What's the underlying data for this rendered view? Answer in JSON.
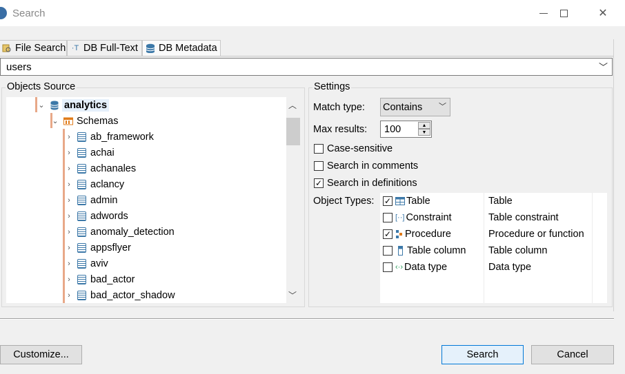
{
  "window": {
    "title": "Search"
  },
  "tabs": [
    {
      "label": "File Search",
      "icon": "file-search-icon"
    },
    {
      "label": "DB Full-Text",
      "icon": "db-full-text-icon"
    },
    {
      "label": "DB Metadata",
      "icon": "db-metadata-icon",
      "active": true
    }
  ],
  "query": {
    "value": "users"
  },
  "objects_source": {
    "label": "Objects Source",
    "root": "analytics",
    "folder": "Schemas",
    "schemas": [
      "ab_framework",
      "achai",
      "achanales",
      "aclancy",
      "admin",
      "adwords",
      "anomaly_detection",
      "appsflyer",
      "aviv",
      "bad_actor",
      "bad_actor_shadow"
    ]
  },
  "settings": {
    "label": "Settings",
    "match_type_label": "Match type:",
    "match_type_value": "Contains",
    "max_results_label": "Max results:",
    "max_results_value": "100",
    "case_sensitive_label": "Case-sensitive",
    "case_sensitive": false,
    "search_comments_label": "Search in comments",
    "search_comments": false,
    "search_definitions_label": "Search in definitions",
    "search_definitions": true,
    "object_types_label": "Object Types:",
    "object_types": [
      {
        "name": "Table",
        "description": "Table",
        "checked": true,
        "icon": "table-icon"
      },
      {
        "name": "Constraint",
        "description": "Table constraint",
        "checked": false,
        "icon": "constraint-icon"
      },
      {
        "name": "Procedure",
        "description": "Procedure or function",
        "checked": true,
        "icon": "procedure-icon"
      },
      {
        "name": "Table column",
        "description": "Table column",
        "checked": false,
        "icon": "column-icon"
      },
      {
        "name": "Data type",
        "description": "Data type",
        "checked": false,
        "icon": "data-type-icon"
      }
    ]
  },
  "buttons": {
    "customize": "Customize...",
    "search": "Search",
    "cancel": "Cancel"
  },
  "colors": {
    "accent": "#3c78a8",
    "tree_guide": "#e8a888",
    "folder": "#e07b1a"
  }
}
